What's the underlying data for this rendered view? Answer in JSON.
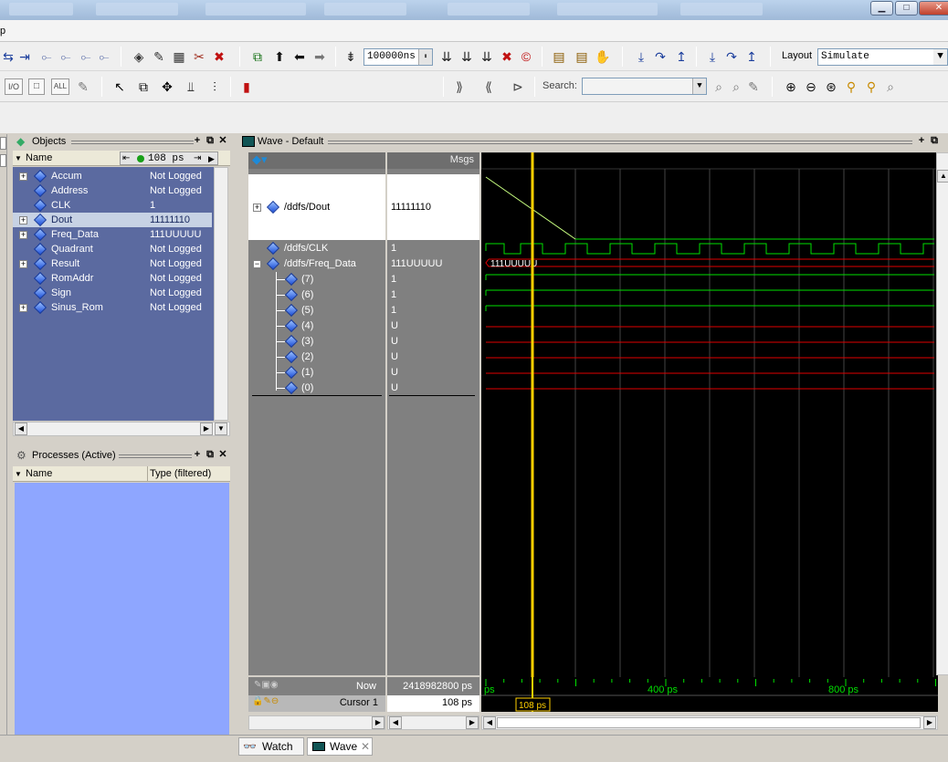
{
  "toolbar": {
    "sim_time": "100000ns",
    "search_label": "Search:",
    "layout_label": "Layout",
    "layout_value": "Simulate",
    "btn_io": "I/O",
    "btn_all": "ALL"
  },
  "objects": {
    "title": "Objects",
    "col_name": "Name",
    "time_value": "108 ps",
    "rows": [
      {
        "name": "Accum",
        "value": "Not Logged"
      },
      {
        "name": "Address",
        "value": "Not Logged"
      },
      {
        "name": "CLK",
        "value": "1"
      },
      {
        "name": "Dout",
        "value": "11111110"
      },
      {
        "name": "Freq_Data",
        "value": "111UUUUU"
      },
      {
        "name": "Quadrant",
        "value": "Not Logged"
      },
      {
        "name": "Result",
        "value": "Not Logged"
      },
      {
        "name": "RomAddr",
        "value": "Not Logged"
      },
      {
        "name": "Sign",
        "value": "Not Logged"
      },
      {
        "name": "Sinus_Rom",
        "value": "Not Logged"
      }
    ]
  },
  "processes": {
    "title": "Processes (Active)",
    "col_name": "Name",
    "col_type": "Type (filtered)"
  },
  "wave": {
    "title": "Wave - Default",
    "msgs_label": "Msgs",
    "signals": [
      {
        "name": "/ddfs/Dout",
        "value": "11111110"
      },
      {
        "name": "/ddfs/CLK",
        "value": "1"
      },
      {
        "name": "/ddfs/Freq_Data",
        "value": "111UUUUU"
      }
    ],
    "bits": [
      {
        "name": "(7)",
        "value": "1"
      },
      {
        "name": "(6)",
        "value": "1"
      },
      {
        "name": "(5)",
        "value": "1"
      },
      {
        "name": "(4)",
        "value": "U"
      },
      {
        "name": "(3)",
        "value": "U"
      },
      {
        "name": "(2)",
        "value": "U"
      },
      {
        "name": "(1)",
        "value": "U"
      },
      {
        "name": "(0)",
        "value": "U"
      }
    ],
    "bus_label": "111UUUUU",
    "now_label": "Now",
    "now_value": "2418982800 ps",
    "cursor_label": "Cursor 1",
    "cursor_value": "108 ps",
    "cursor_flag": "108 ps",
    "time_ticks": [
      "ps",
      "400 ps",
      "800 ps"
    ]
  },
  "tabs": {
    "watch": "Watch",
    "wave": "Wave"
  },
  "colors": {
    "wave_bg": "#000000",
    "signal_green": "#00e000",
    "signal_red": "#e00000",
    "cursor": "#ffd000",
    "object_pane_bg": "#5b6aa0",
    "process_pane_bg": "#8ea6ff"
  }
}
